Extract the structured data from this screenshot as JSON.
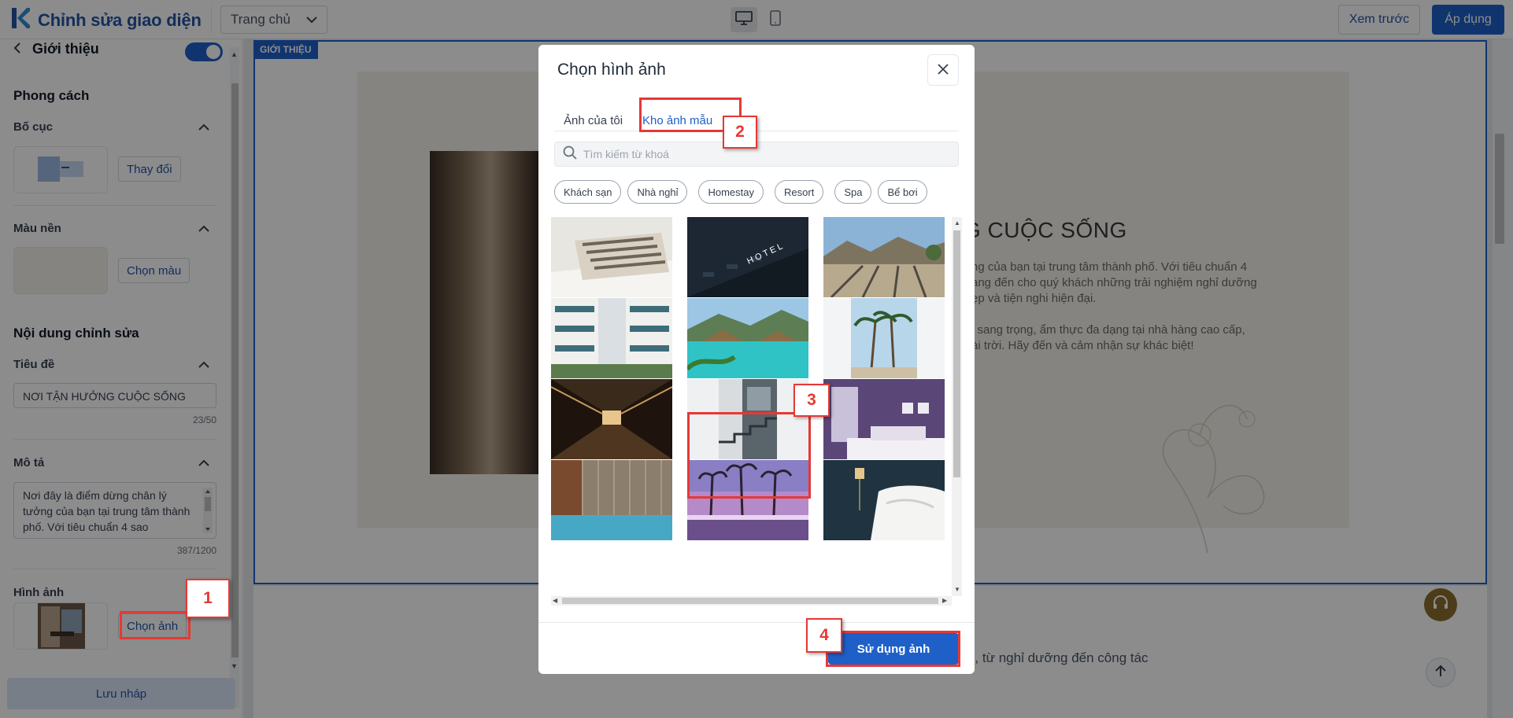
{
  "app": {
    "title": "Chỉnh sửa giao diện",
    "page_select": "Trang chủ",
    "preview_label": "Xem trước",
    "apply_label": "Áp dụng"
  },
  "sidebar": {
    "back_title": "Giới thiệu",
    "style_heading": "Phong cách",
    "layout": {
      "label": "Bố cục",
      "button": "Thay đổi"
    },
    "background": {
      "label": "Màu nền",
      "button": "Chọn màu"
    },
    "content_heading": "Nội dung chỉnh sửa",
    "title_field": {
      "label": "Tiêu đề",
      "value": "NƠI TẬN HƯỞNG CUỘC SỐNG",
      "counter": "23/50"
    },
    "description_field": {
      "label": "Mô tả",
      "value": "Nơi đây là điểm dừng chân lý tưởng của bạn tại trung tâm thành phố. Với tiêu chuẩn 4 sao",
      "counter": "387/1200"
    },
    "image_field": {
      "label": "Hình ảnh",
      "button": "Chọn ảnh"
    },
    "save_draft": "Lưu nháp"
  },
  "canvas": {
    "section_label": "GIỚI THIỆU",
    "heading_partial": "G CUỘC SỐNG",
    "paragraph_lines": [
      "ng của bạn tại trung tâm thành phố. Với tiêu chuẩn 4",
      "ang đến cho quý khách những trải nghiệm nghỉ dưỡng",
      "ẹp và tiện nghi hiện đại.",
      "",
      "i sang trọng, ẩm thực đa dạng tại nhà hàng cao cấp,",
      "ài trời. Hãy đến và cảm nhận sự khác biệt!"
    ],
    "lower_text": "u, từ nghỉ dưỡng đến công tác"
  },
  "modal": {
    "title": "Chọn hình ảnh",
    "tabs": [
      "Ảnh của tôi",
      "Kho ảnh mẫu"
    ],
    "active_tab": 1,
    "search_placeholder": "Tìm kiếm từ khoá",
    "chips": [
      "Khách sạn",
      "Nhà nghỉ",
      "Homestay",
      "Resort",
      "Spa",
      "Bể bơi"
    ],
    "use_button": "Sử dụng ảnh",
    "selected_image_index": 7,
    "images": [
      "bed-pillows",
      "hotel-sign-night",
      "mountain-resort-loungers",
      "hotel-balconies",
      "tropical-pool",
      "palm-trees",
      "hotel-corridor",
      "modern-staircase",
      "purple-bedroom",
      "indoor-pool",
      "palm-sunset-pool",
      "dark-bedroom-lamp"
    ]
  },
  "annotations": [
    "1",
    "2",
    "3",
    "4"
  ],
  "colors": {
    "brand": "#2455a6",
    "primary": "#1e5fc8",
    "annotation": "#e53935",
    "accent_gold": "#8a6e2f"
  }
}
